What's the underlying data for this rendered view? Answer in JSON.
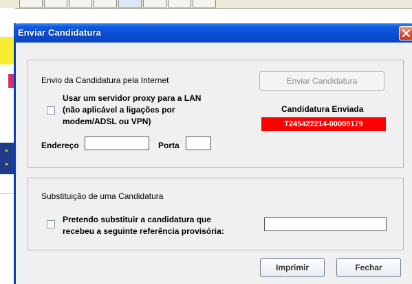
{
  "dialog": {
    "title": "Enviar Candidatura"
  },
  "internet": {
    "section_title": "Envio da Candidatura pela Internet",
    "proxy_line1": "Usar um servidor proxy para a LAN",
    "proxy_line2": "(não aplicável a ligações por",
    "proxy_line3": "modem/ADSL ou VPN)",
    "proxy_checked": false,
    "address_label": "Endereço",
    "address_value": "",
    "port_label": "Porta",
    "port_value": "",
    "send_button": "Enviar Candidatura",
    "sent_label": "Candidatura Enviada",
    "sent_reference": "T245422214-00009179"
  },
  "replacement": {
    "section_title": "Substituição de uma Candidatura",
    "line1": "Pretendo substituir a candidatura que",
    "line2": "recebeu a seguinte referência provisória:",
    "checked": false,
    "reference_value": ""
  },
  "footer": {
    "print_button": "Imprimir",
    "close_button": "Fechar"
  },
  "colors": {
    "title_bar": "#0a4cd2",
    "reference_bg": "#ff0000",
    "reference_text": "#ffffff"
  }
}
